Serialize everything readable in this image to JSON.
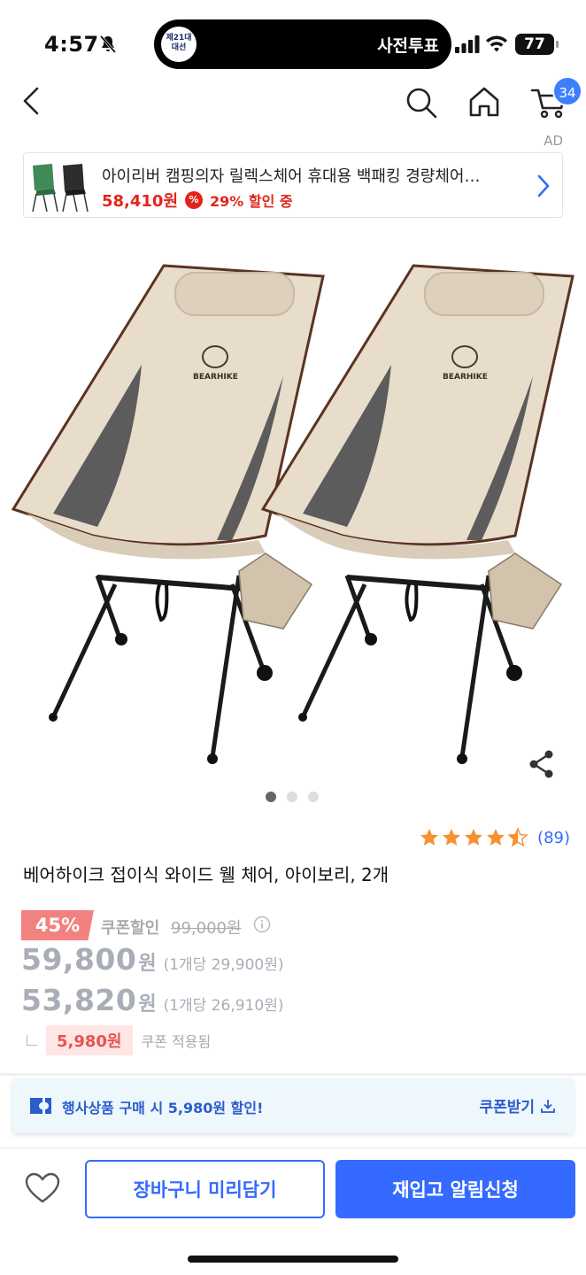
{
  "status_bar": {
    "time": "4:57",
    "island_badge": "제21대 대선",
    "island_text": "사전투표",
    "battery": "77"
  },
  "nav": {
    "cart_count": "34"
  },
  "ad": {
    "label": "AD",
    "title": "아이리버 캠핑의자 릴렉스체어 휴대용 백패킹 경량체어…",
    "price": "58,410원",
    "discount_icon": "%",
    "discount_text": "29% 할인 중"
  },
  "product": {
    "brand_on_image": "BEARHIKE",
    "image_dots": [
      true,
      false,
      false
    ],
    "rating": 4.5,
    "review_count": "(89)",
    "title": "베어하이크 접이식 와이드 웰 체어, 아이보리, 2개"
  },
  "pricing": {
    "discount_badge": "45%",
    "coupon_discount_label": "쿠폰할인",
    "original_price": "99,000원",
    "price1": "59,800",
    "price1_unit": "원",
    "price1_per_unit": "(1개당 29,900원)",
    "price2": "53,820",
    "price2_unit": "원",
    "price2_per_unit": "(1개당 26,910원)",
    "coupon_amount": "5,980원",
    "coupon_applied": "쿠폰 적용됨"
  },
  "promo": {
    "text": "행사상품 구매 시 5,980원 할인!",
    "get_coupon": "쿠폰받기"
  },
  "bottom_bar": {
    "cart_button": "장바구니 미리담기",
    "restock_button": "재입고 알림신청"
  },
  "colors": {
    "accent_blue": "#346aff",
    "sale_red": "#e1251b",
    "badge_pink": "#f1827f",
    "muted_gray": "#a8adb8"
  },
  "icons": [
    "bell-off-icon",
    "signal-icon",
    "wifi-icon",
    "back-icon",
    "search-icon",
    "home-icon",
    "cart-icon",
    "chevron-right-icon",
    "share-icon",
    "star-icon",
    "info-icon",
    "coupon-icon",
    "download-icon",
    "heart-icon"
  ]
}
